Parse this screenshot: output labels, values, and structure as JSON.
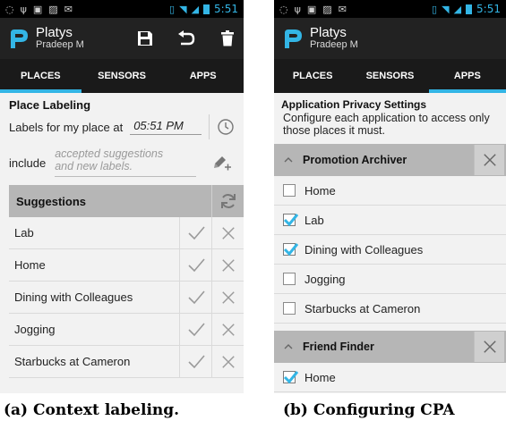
{
  "status": {
    "time": "5:51"
  },
  "app": {
    "title": "Platys",
    "subtitle": "Pradeep M"
  },
  "tabs": [
    "PLACES",
    "SENSORS",
    "APPS"
  ],
  "colors": {
    "accent": "#33b5e5",
    "check": "#33b5e5"
  },
  "screen_a": {
    "section_title": "Place Labeling",
    "labels_prefix": "Labels for my place at",
    "time_value": "05:51 PM",
    "include_label": "include",
    "include_hint_line1": "accepted suggestions",
    "include_hint_line2": "and new labels.",
    "suggestions_header": "Suggestions",
    "suggestions": [
      "Lab",
      "Home",
      "Dining with Colleagues",
      "Jogging",
      "Starbucks at Cameron"
    ]
  },
  "screen_b": {
    "title": "Application Privacy Settings",
    "desc_line1": "Configure each application to access only",
    "desc_line2": "those places it must.",
    "groups": [
      {
        "name": "Promotion Archiver",
        "places": [
          {
            "label": "Home",
            "checked": false
          },
          {
            "label": "Lab",
            "checked": true
          },
          {
            "label": "Dining with Colleagues",
            "checked": true
          },
          {
            "label": "Jogging",
            "checked": false
          },
          {
            "label": "Starbucks at Cameron",
            "checked": false
          }
        ]
      },
      {
        "name": "Friend Finder",
        "places": [
          {
            "label": "Home",
            "checked": true
          }
        ]
      }
    ]
  },
  "captions": {
    "a": "(a) Context labeling.",
    "b": "(b) Configuring CPA"
  }
}
